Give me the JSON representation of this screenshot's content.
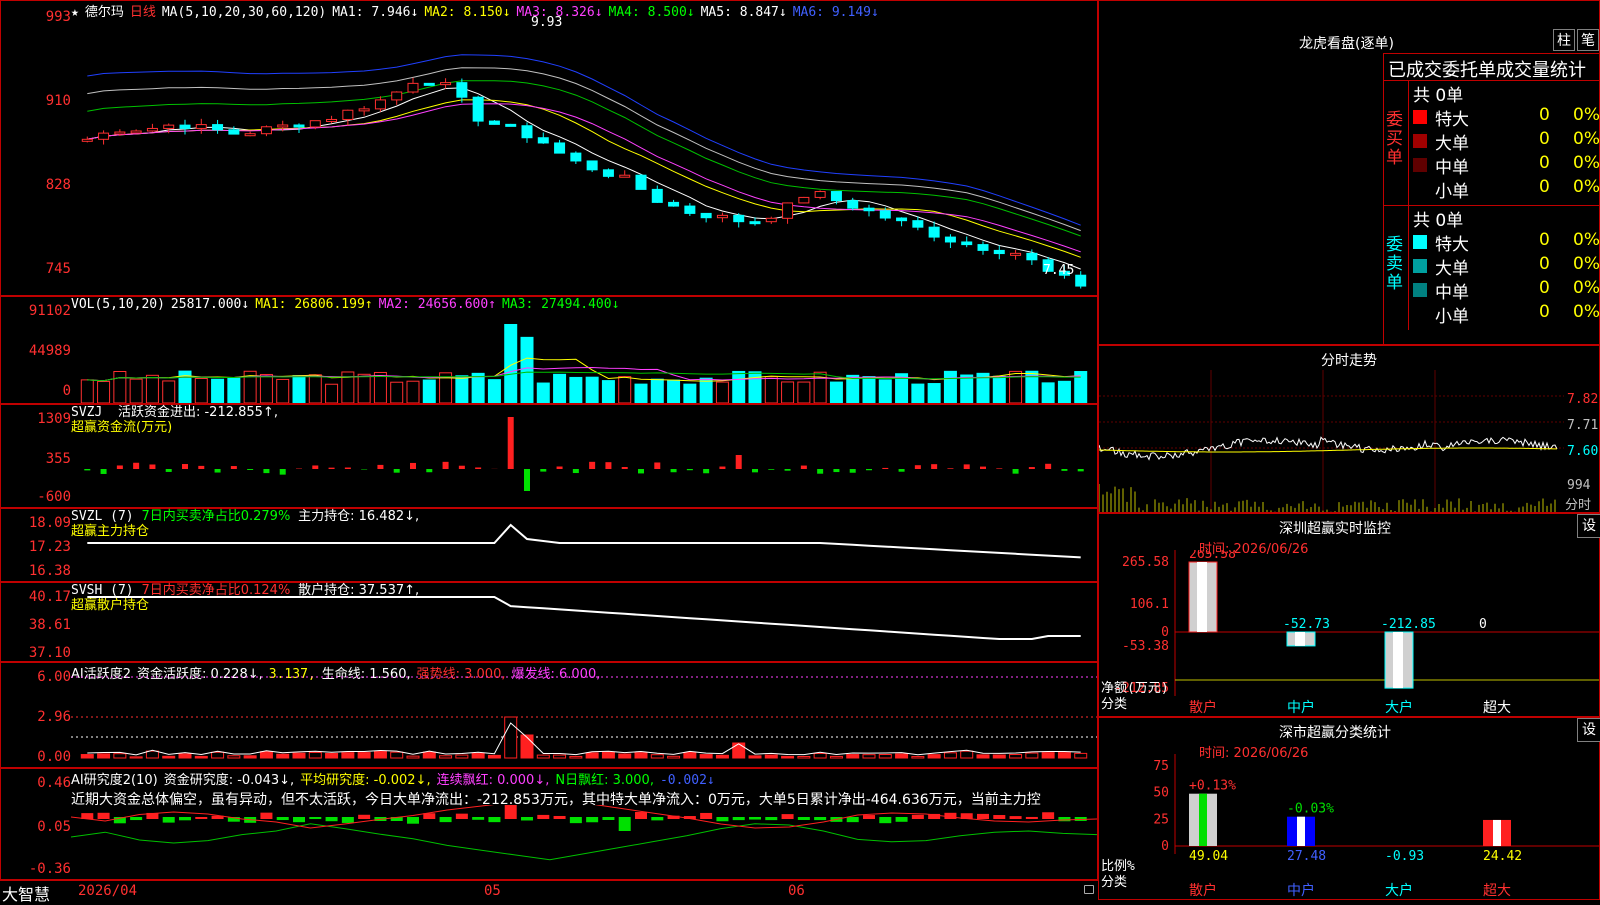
{
  "app": {
    "name": "大智慧",
    "stock": "德尔玛",
    "period": "日线"
  },
  "kline": {
    "header": {
      "star": "★",
      "ma_params": "MA(5,10,20,30,60,120)",
      "ma1": "MA1: 7.946↓",
      "ma2": "MA2: 8.150↓",
      "ma3": "MA3: 8.326↓",
      "ma4": "MA4: 8.500↓",
      "ma5": "MA5: 8.847↓",
      "ma6": "MA6: 9.149↓"
    },
    "yticks": [
      "993",
      "910",
      "828",
      "745"
    ],
    "high_label": "9.93",
    "low_label": "7.45"
  },
  "vol": {
    "header": {
      "name": "VOL(5,10,20)",
      "value": "25817.000↓",
      "ma1": "MA1: 26806.199↑",
      "ma2": "MA2: 24656.600↑",
      "ma3": "MA3: 27494.400↓"
    },
    "yticks": [
      "91102",
      "44989",
      "0"
    ]
  },
  "svzj": {
    "header": {
      "name": "SVZJ",
      "label": "活跃资金进出: -212.855↑,",
      "sub": "超赢资金流(万元)"
    },
    "yticks": [
      "1309",
      "355",
      "-600"
    ]
  },
  "svzl": {
    "header": {
      "name": "SVZL (7)",
      "ratio": "7日内买卖净占比0.279%",
      "hold": "主力持仓: 16.482↓,",
      "sub": "超赢主力持仓"
    },
    "yticks": [
      "18.09",
      "17.23",
      "16.38"
    ]
  },
  "svsh": {
    "header": {
      "name": "SVSH (7)",
      "ratio": "7日内买卖净占比0.124%",
      "hold": "散户持仓: 37.537↑,",
      "sub": "超赢散户持仓"
    },
    "yticks": [
      "40.17",
      "38.61",
      "37.10"
    ]
  },
  "ai_active": {
    "header": {
      "name": "AI活跃度2",
      "act": "资金活跃度: 0.228↓,",
      "v2": "3.137,",
      "life": "生命线: 1.560,",
      "strong": "强势线: 3.000,",
      "burst": "爆发线: 6.000,"
    },
    "yticks": [
      "6.00",
      "2.96",
      "0.00"
    ]
  },
  "ai_research": {
    "header": {
      "name": "AI研究度2(10)",
      "res": "资金研究度: -0.043↓,",
      "avg": "平均研究度: -0.002↓,",
      "red": "连续飘红: 0.000↓,",
      "nred": "N日飘红: 3.000,",
      "v": "-0.002↓"
    },
    "comment": "近期大资金总体偏空，虽有异动，但不太活跃，今日大单净流出：-212.853万元，其中特大单净流入：0万元，大单5日累计净出-464.636万元，当前主力控",
    "yticks": [
      "0.46",
      "0.05",
      "-0.36"
    ]
  },
  "xaxis": {
    "labels": [
      "2026/04",
      "05",
      "06"
    ]
  },
  "right": {
    "lhb": {
      "title": "龙虎看盘(逐单)",
      "btn1": "柱",
      "btn2": "笔",
      "tabs": "已成交委托单成交量统计",
      "buy": {
        "side": "委买单",
        "total": "共 0单",
        "rows": [
          {
            "name": "特大",
            "v": "0",
            "p": "0%",
            "color": "#ff0000"
          },
          {
            "name": "大单",
            "v": "0",
            "p": "0%",
            "color": "#a00000"
          },
          {
            "name": "中单",
            "v": "0",
            "p": "0%",
            "color": "#600000"
          },
          {
            "name": "小单",
            "v": "0",
            "p": "0%",
            "color": "#000000"
          }
        ]
      },
      "sell": {
        "side": "委卖单",
        "total": "共 0单",
        "rows": [
          {
            "name": "特大",
            "v": "0",
            "p": "0%",
            "color": "#00ffff"
          },
          {
            "name": "大单",
            "v": "0",
            "p": "0%",
            "color": "#00a0a0"
          },
          {
            "name": "中单",
            "v": "0",
            "p": "0%",
            "color": "#008080"
          },
          {
            "name": "小单",
            "v": "0",
            "p": "0%",
            "color": "#000000"
          }
        ]
      }
    },
    "fenshi": {
      "title": "分时走势",
      "yticks": [
        "7.82",
        "7.71",
        "7.60"
      ],
      "vol": "994",
      "label": "分时"
    },
    "monitor": {
      "title": "深圳超赢实时监控",
      "btn": "设",
      "time": "时间: 2026/06/26",
      "yticks": [
        "265.58",
        "106.1",
        "0",
        "-53.38",
        "-212.85"
      ],
      "ylabel": "净额(万元)",
      "xlabel": "分类",
      "bars": [
        {
          "cat": "散户",
          "val": "265.58"
        },
        {
          "cat": "中户",
          "val": "-52.73"
        },
        {
          "cat": "大户",
          "val": "-212.85"
        },
        {
          "cat": "超大",
          "val": "0"
        }
      ]
    },
    "classify": {
      "title": "深市超赢分类统计",
      "btn": "设",
      "time": "时间: 2026/06/26",
      "yticks": [
        "75",
        "50",
        "25",
        "0"
      ],
      "ylabel": "比例%",
      "xlabel": "分类",
      "tops": [
        "+0.13%",
        "-0.03%"
      ],
      "bars": [
        {
          "cat": "散户",
          "val": "49.04"
        },
        {
          "cat": "中户",
          "val": "27.48"
        },
        {
          "cat": "大户",
          "val": "-0.93"
        },
        {
          "cat": "超大",
          "val": "24.42"
        }
      ]
    }
  },
  "chart_data": {
    "type": "bar",
    "title": "",
    "categories": [
      "散户",
      "中户",
      "大户",
      "超大"
    ],
    "series": [
      {
        "name": "净额(万元)",
        "values": [
          265.58,
          -52.73,
          -212.85,
          0
        ]
      }
    ]
  }
}
